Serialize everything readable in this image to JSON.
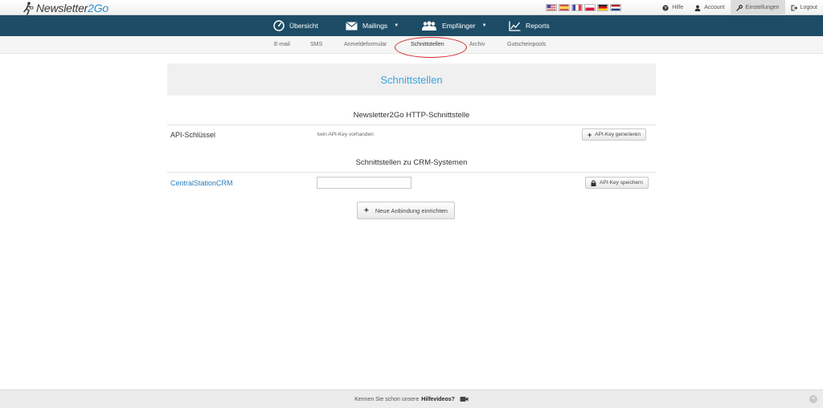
{
  "brand": {
    "name_part1": "Newsletter",
    "name_part2": "2Go"
  },
  "languages": [
    "english-flag",
    "spanish-flag",
    "french-flag",
    "polish-flag",
    "german-flag",
    "dutch-flag"
  ],
  "top_links": {
    "help": "Hilfe",
    "account": "Account",
    "settings": "Einstellungen",
    "logout": "Logout"
  },
  "main_nav": {
    "overview": "Übersicht",
    "mailings": "Mailings",
    "recipients": "Empfänger",
    "reports": "Reports"
  },
  "sub_nav": {
    "email": "E-mail",
    "sms": "SMS",
    "signup_form": "Anmeldeformular",
    "interfaces": "Schnittstellen",
    "archive": "Archiv",
    "voucher_pools": "Gutscheinpools"
  },
  "page": {
    "title": "Schnittstellen",
    "http_section": "Newsletter2Go HTTP-Schnittstelle",
    "api_key_label": "API-Schlüssel",
    "api_key_status": "kein API-Key vorhanden",
    "generate_button": "API-Key generieren",
    "crm_section": "Schnittstellen zu CRM-Systemen",
    "crm_name": "CentralStationCRM",
    "crm_input_value": "",
    "save_button": "API-Key speichern",
    "new_connection_button": "Neue Anbindung einrichten"
  },
  "footer": {
    "text": "Kennen Sie schon unsere",
    "link": "Hilfevideos?"
  },
  "colors": {
    "nav_bg": "#1d4c66",
    "title_accent": "#3ea3de",
    "link": "#2b7bb9",
    "highlight_circle": "#d12a2a"
  }
}
